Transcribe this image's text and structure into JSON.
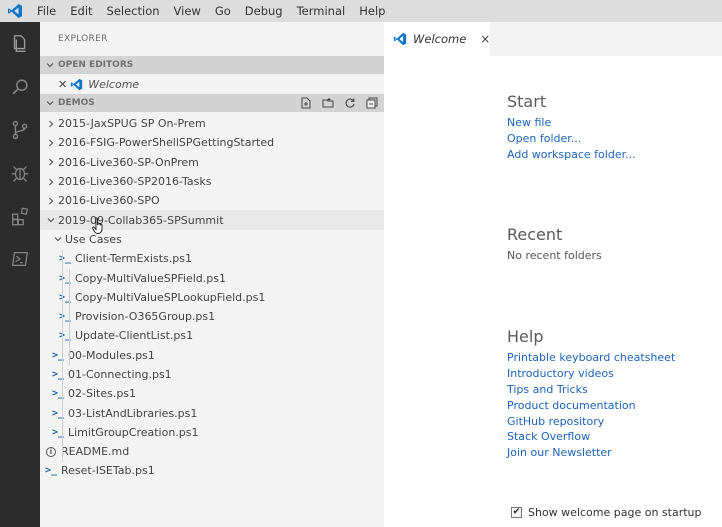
{
  "menubar": {
    "items": [
      "File",
      "Edit",
      "Selection",
      "View",
      "Go",
      "Debug",
      "Terminal",
      "Help"
    ]
  },
  "activity_bar": {
    "icons": [
      "explorer-icon",
      "search-icon",
      "source-control-icon",
      "debug-icon",
      "extensions-icon",
      "powershell-icon"
    ]
  },
  "sidebar": {
    "title": "EXPLORER",
    "open_editors": {
      "header": "OPEN EDITORS",
      "items": [
        {
          "label": "Welcome",
          "icon": "vscode-icon"
        }
      ]
    },
    "workspace": {
      "header": "DEMOS",
      "actions": [
        "new-file-icon",
        "new-folder-icon",
        "refresh-icon",
        "collapse-all-icon"
      ],
      "tree": [
        {
          "label": "2015-JaxSPUG SP On-Prem",
          "type": "folder",
          "expanded": false,
          "depth": 0
        },
        {
          "label": "2016-FSIG-PowerShellSPGettingStarted",
          "type": "folder",
          "expanded": false,
          "depth": 0
        },
        {
          "label": "2016-Live360-SP-OnPrem",
          "type": "folder",
          "expanded": false,
          "depth": 0
        },
        {
          "label": "2016-Live360-SP2016-Tasks",
          "type": "folder",
          "expanded": false,
          "depth": 0
        },
        {
          "label": "2016-Live360-SPO",
          "type": "folder",
          "expanded": false,
          "depth": 0
        },
        {
          "label": "2019-09-Collab365-SPSummit",
          "type": "folder",
          "expanded": true,
          "depth": 0
        },
        {
          "label": "Use Cases",
          "type": "folder",
          "expanded": true,
          "depth": 1
        },
        {
          "label": "Client-TermExists.ps1",
          "type": "ps1",
          "depth": 2
        },
        {
          "label": "Copy-MultiValueSPField.ps1",
          "type": "ps1",
          "depth": 2
        },
        {
          "label": "Copy-MultiValueSPLookupField.ps1",
          "type": "ps1",
          "depth": 2
        },
        {
          "label": "Provision-O365Group.ps1",
          "type": "ps1",
          "depth": 2
        },
        {
          "label": "Update-ClientList.ps1",
          "type": "ps1",
          "depth": 2
        },
        {
          "label": "00-Modules.ps1",
          "type": "ps1",
          "depth": 1
        },
        {
          "label": "01-Connecting.ps1",
          "type": "ps1",
          "depth": 1
        },
        {
          "label": "02-Sites.ps1",
          "type": "ps1",
          "depth": 1
        },
        {
          "label": "03-ListAndLibraries.ps1",
          "type": "ps1",
          "depth": 1
        },
        {
          "label": "LimitGroupCreation.ps1",
          "type": "ps1",
          "depth": 1
        },
        {
          "label": "README.md",
          "type": "md",
          "depth": 0
        },
        {
          "label": "Reset-ISETab.ps1",
          "type": "ps1",
          "depth": 0
        }
      ]
    }
  },
  "editor": {
    "tab": {
      "label": "Welcome",
      "close": "×"
    },
    "welcome": {
      "start": {
        "heading": "Start",
        "links": [
          "New file",
          "Open folder...",
          "Add workspace folder..."
        ]
      },
      "recent": {
        "heading": "Recent",
        "text": "No recent folders"
      },
      "help": {
        "heading": "Help",
        "links": [
          "Printable keyboard cheatsheet",
          "Introductory videos",
          "Tips and Tricks",
          "Product documentation",
          "GitHub repository",
          "Stack Overflow",
          "Join our Newsletter"
        ]
      },
      "startup_checkbox": {
        "label": "Show welcome page on startup",
        "checked": true
      }
    }
  },
  "colors": {
    "menubar": "#dddddd",
    "activity_bar": "#2c2c2c",
    "sidebar": "#f3f3f3",
    "section_header": "#d3d3d3",
    "link": "#1c63b8",
    "vscode_blue": "#0e76c6"
  }
}
